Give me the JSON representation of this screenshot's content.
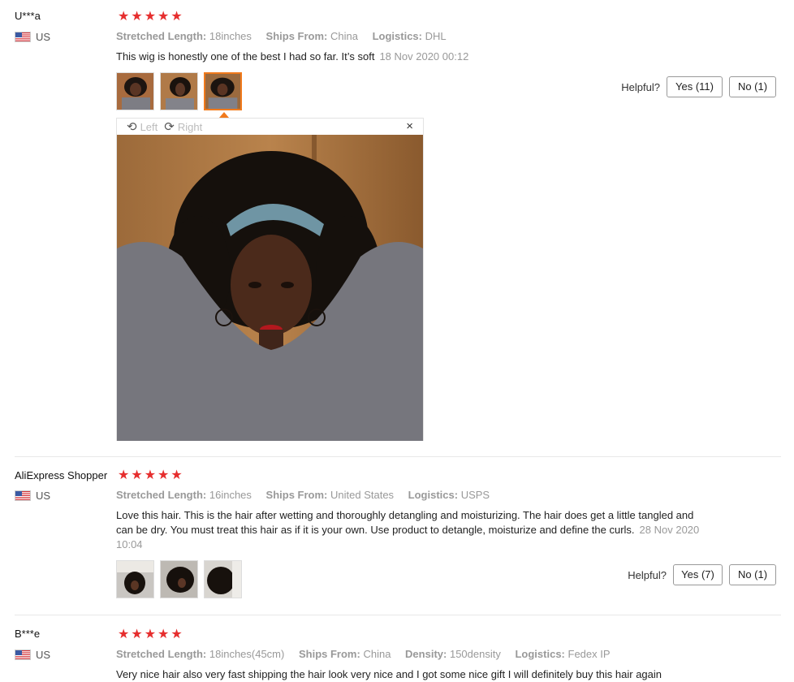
{
  "reviews": [
    {
      "user": "U***a",
      "country": "US",
      "stars": 5,
      "attributes": [
        {
          "key": "Stretched Length:",
          "value": "18inches"
        },
        {
          "key": "Ships From:",
          "value": "China"
        },
        {
          "key": "Logistics:",
          "value": "DHL"
        }
      ],
      "text": "This wig is honestly one of the best I had so far. It’s soft",
      "date": "18 Nov 2020 00:12",
      "helpful_label": "Helpful?",
      "yes_label": "Yes (11)",
      "no_label": "No (1)",
      "viewer": {
        "left_label": "Left",
        "right_label": "Right",
        "close_symbol": "×"
      }
    },
    {
      "user": "AliExpress Shopper",
      "country": "US",
      "stars": 5,
      "attributes": [
        {
          "key": "Stretched Length:",
          "value": "16inches"
        },
        {
          "key": "Ships From:",
          "value": "United States"
        },
        {
          "key": "Logistics:",
          "value": "USPS"
        }
      ],
      "text": "Love this hair. This is the hair after wetting and thoroughly detangling and moisturizing. The hair does get a little tangled and can be dry. You must treat this hair as if it is your own. Use product to detangle, moisturize and define the curls.",
      "date": "28 Nov 2020 10:04",
      "helpful_label": "Helpful?",
      "yes_label": "Yes (7)",
      "no_label": "No (1)"
    },
    {
      "user": "B***e",
      "country": "US",
      "stars": 5,
      "attributes": [
        {
          "key": "Stretched Length:",
          "value": "18inches(45cm)"
        },
        {
          "key": "Ships From:",
          "value": "China"
        },
        {
          "key": "Density:",
          "value": "150density"
        },
        {
          "key": "Logistics:",
          "value": "Fedex IP"
        }
      ],
      "text": "Very nice hair also very fast shipping the hair look very nice and I got some nice gift I will definitely buy this hair again"
    }
  ],
  "colors": {
    "star": "#e62e2e",
    "selected_thumb": "#f17a1c",
    "muted_text": "#999999"
  }
}
